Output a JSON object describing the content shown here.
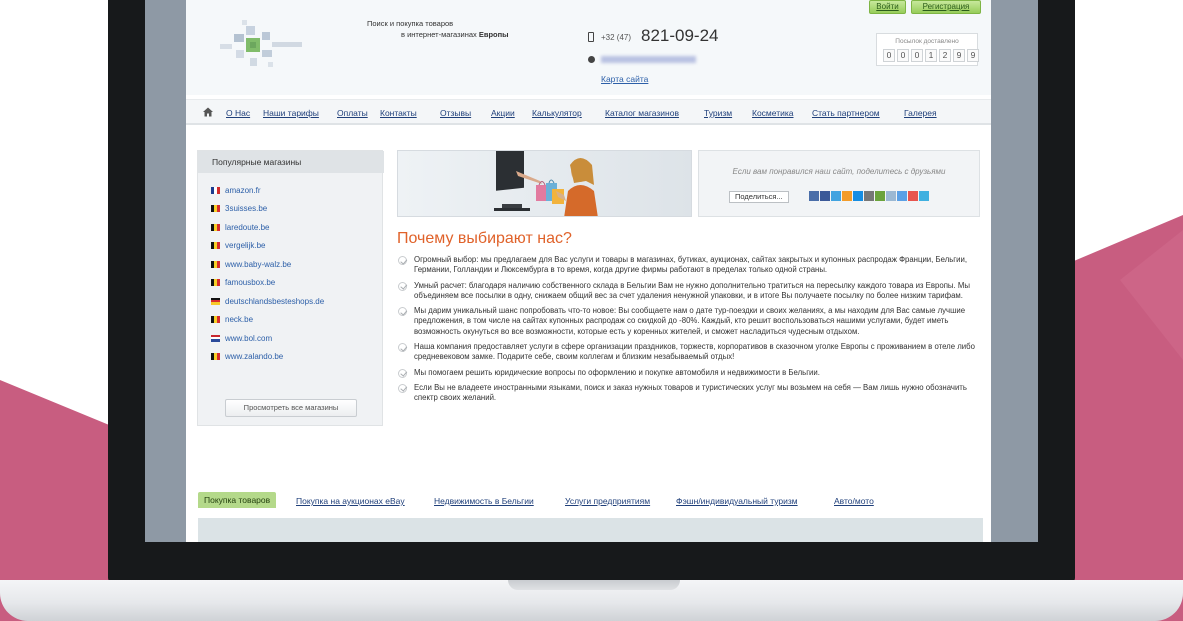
{
  "header": {
    "tagline_line1": "Поиск и покупка товаров",
    "tagline_line2_prefix": "в интернет-магазинах ",
    "tagline_line2_bold": "Европы",
    "phone_prefix": "+32 (47)",
    "phone_number": "821-09-24",
    "sitemap_link": "Карта сайта",
    "login_label": "Войти",
    "register_label": "Регистрация",
    "counter_label": "Посылок доставлено",
    "counter_digits": [
      "0",
      "0",
      "0",
      "1",
      "2",
      "9",
      "9"
    ]
  },
  "nav": {
    "items": [
      "О Нас",
      "Наши тарифы",
      "Оплаты",
      "Контакты",
      "Отзывы",
      "Акции",
      "Калькулятор",
      "Каталог магазинов",
      "Туризм",
      "Косметика",
      "Стать партнером",
      "Галерея"
    ]
  },
  "sidebar": {
    "title": "Популярные магазины",
    "stores": [
      {
        "name": "amazon.fr",
        "flag": "fr"
      },
      {
        "name": "3suisses.be",
        "flag": "be"
      },
      {
        "name": "laredoute.be",
        "flag": "be"
      },
      {
        "name": "vergelijk.be",
        "flag": "be"
      },
      {
        "name": "www.baby-walz.be",
        "flag": "be"
      },
      {
        "name": "famousbox.be",
        "flag": "be"
      },
      {
        "name": "deutschlandsbesteshops.de",
        "flag": "de"
      },
      {
        "name": "neck.be",
        "flag": "be"
      },
      {
        "name": "www.bol.com",
        "flag": "nl"
      },
      {
        "name": "www.zalando.be",
        "flag": "be"
      }
    ],
    "all_stores_button": "Просмотреть все магазины"
  },
  "share": {
    "text": "Если вам понравился наш сайт, поделитесь с друзьями",
    "button_label": "Поделиться..."
  },
  "main": {
    "title": "Почему выбирают нас?",
    "reasons": [
      "Огромный выбор: мы предлагаем для Вас услуги и товары в магазинах, бутиках, аукционах, сайтах закрытых и купонных распродаж Франции, Бельгии, Германии, Голландии и Люксембурга в то время, когда другие фирмы работают в пределах только одной страны.",
      "Умный расчет: благодаря наличию собственного склада в Бельгии Вам не нужно дополнительно тратиться на пересылку каждого товара из Европы. Мы объединяем все посылки в одну, снижаем общий вес за счет удаления ненужной упаковки, и в итоге Вы получаете посылку по более низким тарифам.",
      "Мы дарим уникальный шанс попробовать что-то новое: Вы сообщаете нам о дате тур-поездки и своих желаниях, а мы находим для Вас самые лучшие предложения, в том числе на сайтах купонных распродаж со скидкой до -80%. Каждый, кто решит воспользоваться нашими услугами, будет иметь возможность окунуться во все возможности, которые есть у коренных жителей, и сможет насладиться чудесным отдыхом.",
      "Наша компания предоставляет услуги в сфере организации праздников, торжеств, корпоративов в сказочном уголке Европы с проживанием в отеле либо средневековом замке. Подарите себе, своим коллегам и близким незабываемый отдых!",
      "Мы помогаем решить юридические вопросы по оформлению и покупке автомобиля и недвижимости в Бельгии.",
      "Если Вы не владеете иностранными языками, поиск и заказ нужных товаров и туристических услуг мы возьмем на себя — Вам лишь нужно обозначить спектр своих желаний."
    ]
  },
  "tabs": [
    "Покупка товаров",
    "Покупка на аукционах eBay",
    "Недвижимость в Бельгии",
    "Услуги предприятиям",
    "Фэшн/индивидуальный туризм",
    "Авто/мото"
  ],
  "colors": {
    "background_pink": "#c85d80",
    "accent_orange": "#e0622a",
    "link_blue": "#1f3f7a",
    "green_button": "#97cd5a"
  }
}
